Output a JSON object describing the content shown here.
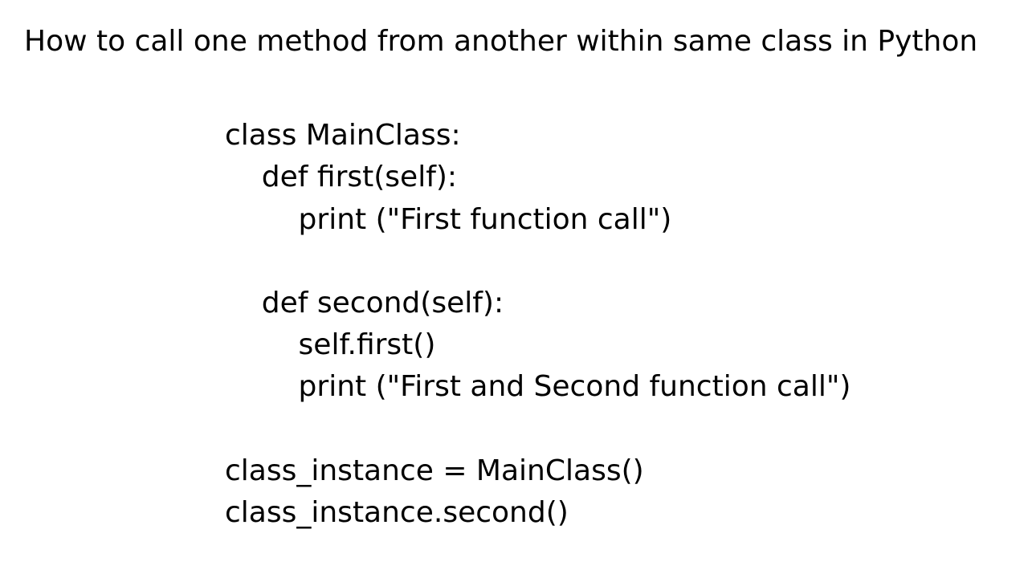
{
  "title": "How to call one method from another within same class in Python",
  "code": {
    "line1": "class MainClass:",
    "line2": "    def first(self):",
    "line3": "        print (\"First function call\")",
    "line4": "",
    "line5": "    def second(self):",
    "line6": "        self.first()",
    "line7": "        print (\"First and Second function call\")",
    "line8": "",
    "line9": "class_instance = MainClass()",
    "line10": "class_instance.second()"
  }
}
